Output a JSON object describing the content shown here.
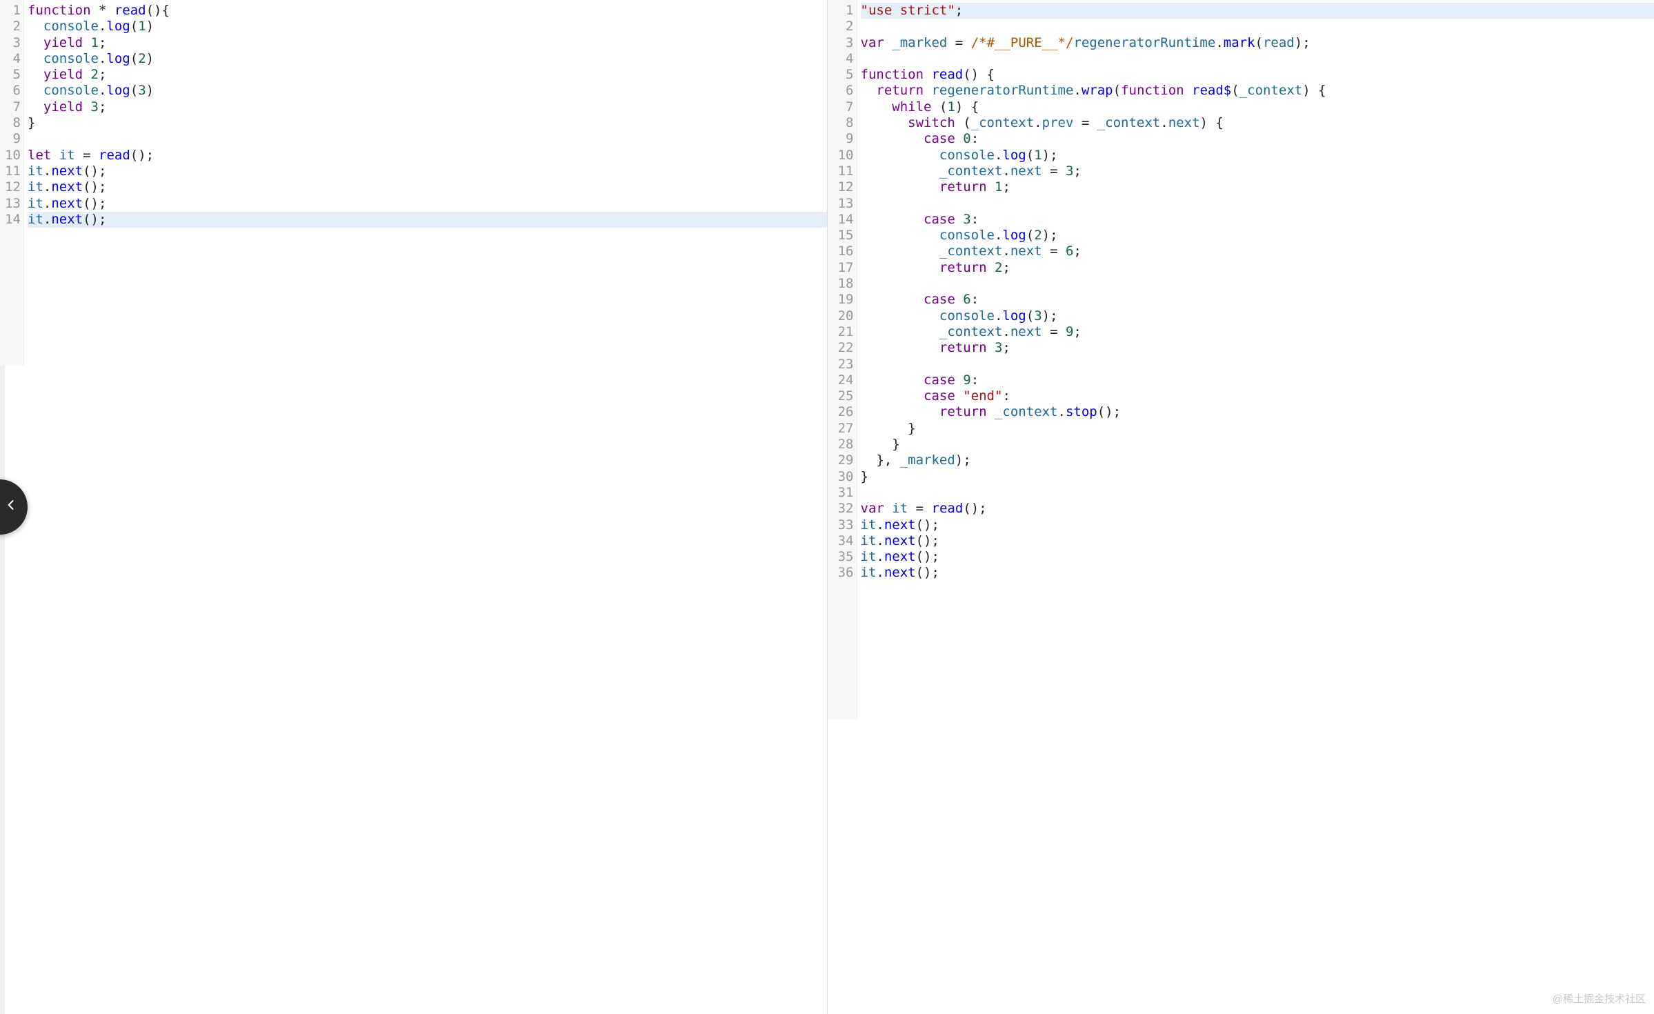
{
  "watermark": "@稀土掘金技术社区",
  "leftPanel": {
    "highlightedLines": [
      14
    ],
    "lines": [
      {
        "n": 1,
        "tokens": [
          {
            "c": "kw",
            "t": "function"
          },
          {
            "t": " * "
          },
          {
            "c": "fn",
            "t": "read"
          },
          {
            "t": "(){"
          }
        ]
      },
      {
        "n": 2,
        "tokens": [
          {
            "t": "  "
          },
          {
            "c": "v",
            "t": "console"
          },
          {
            "t": "."
          },
          {
            "c": "fn",
            "t": "log"
          },
          {
            "t": "("
          },
          {
            "c": "num",
            "t": "1"
          },
          {
            "t": ")"
          }
        ]
      },
      {
        "n": 3,
        "tokens": [
          {
            "t": "  "
          },
          {
            "c": "kw",
            "t": "yield"
          },
          {
            "t": " "
          },
          {
            "c": "num",
            "t": "1"
          },
          {
            "t": ";"
          }
        ]
      },
      {
        "n": 4,
        "tokens": [
          {
            "t": "  "
          },
          {
            "c": "v",
            "t": "console"
          },
          {
            "t": "."
          },
          {
            "c": "fn",
            "t": "log"
          },
          {
            "t": "("
          },
          {
            "c": "num",
            "t": "2"
          },
          {
            "t": ")"
          }
        ]
      },
      {
        "n": 5,
        "tokens": [
          {
            "t": "  "
          },
          {
            "c": "kw",
            "t": "yield"
          },
          {
            "t": " "
          },
          {
            "c": "num",
            "t": "2"
          },
          {
            "t": ";"
          }
        ]
      },
      {
        "n": 6,
        "tokens": [
          {
            "t": "  "
          },
          {
            "c": "v",
            "t": "console"
          },
          {
            "t": "."
          },
          {
            "c": "fn",
            "t": "log"
          },
          {
            "t": "("
          },
          {
            "c": "num",
            "t": "3"
          },
          {
            "t": ")"
          }
        ]
      },
      {
        "n": 7,
        "tokens": [
          {
            "t": "  "
          },
          {
            "c": "kw",
            "t": "yield"
          },
          {
            "t": " "
          },
          {
            "c": "num",
            "t": "3"
          },
          {
            "t": ";"
          }
        ]
      },
      {
        "n": 8,
        "tokens": [
          {
            "t": "}"
          }
        ]
      },
      {
        "n": 9,
        "tokens": []
      },
      {
        "n": 10,
        "tokens": [
          {
            "c": "kw",
            "t": "let"
          },
          {
            "t": " "
          },
          {
            "c": "v",
            "t": "it"
          },
          {
            "t": " = "
          },
          {
            "c": "fn",
            "t": "read"
          },
          {
            "t": "();"
          }
        ]
      },
      {
        "n": 11,
        "tokens": [
          {
            "c": "v",
            "t": "it"
          },
          {
            "t": "."
          },
          {
            "c": "fn",
            "t": "next"
          },
          {
            "t": "();"
          }
        ]
      },
      {
        "n": 12,
        "tokens": [
          {
            "c": "v",
            "t": "it"
          },
          {
            "t": "."
          },
          {
            "c": "fn",
            "t": "next"
          },
          {
            "t": "();"
          }
        ]
      },
      {
        "n": 13,
        "tokens": [
          {
            "c": "v",
            "t": "it"
          },
          {
            "t": "."
          },
          {
            "c": "fn",
            "t": "next"
          },
          {
            "t": "();"
          }
        ]
      },
      {
        "n": 14,
        "tokens": [
          {
            "c": "v",
            "t": "it"
          },
          {
            "t": "."
          },
          {
            "c": "fn",
            "t": "next"
          },
          {
            "t": "();"
          }
        ]
      }
    ]
  },
  "rightPanel": {
    "highlightedLines": [
      1
    ],
    "lines": [
      {
        "n": 1,
        "tokens": [
          {
            "c": "str",
            "t": "\"use strict\""
          },
          {
            "t": ";"
          }
        ]
      },
      {
        "n": 2,
        "tokens": []
      },
      {
        "n": 3,
        "tokens": [
          {
            "c": "kw",
            "t": "var"
          },
          {
            "t": " "
          },
          {
            "c": "v",
            "t": "_marked"
          },
          {
            "t": " = "
          },
          {
            "c": "com",
            "t": "/*#__PURE__*/"
          },
          {
            "c": "v",
            "t": "regeneratorRuntime"
          },
          {
            "t": "."
          },
          {
            "c": "fn",
            "t": "mark"
          },
          {
            "t": "("
          },
          {
            "c": "v",
            "t": "read"
          },
          {
            "t": ");"
          }
        ]
      },
      {
        "n": 4,
        "tokens": []
      },
      {
        "n": 5,
        "tokens": [
          {
            "c": "kw",
            "t": "function"
          },
          {
            "t": " "
          },
          {
            "c": "fn",
            "t": "read"
          },
          {
            "t": "() {"
          }
        ]
      },
      {
        "n": 6,
        "tokens": [
          {
            "t": "  "
          },
          {
            "c": "kw",
            "t": "return"
          },
          {
            "t": " "
          },
          {
            "c": "v",
            "t": "regeneratorRuntime"
          },
          {
            "t": "."
          },
          {
            "c": "fn",
            "t": "wrap"
          },
          {
            "t": "("
          },
          {
            "c": "kw",
            "t": "function"
          },
          {
            "t": " "
          },
          {
            "c": "fn",
            "t": "read$"
          },
          {
            "t": "("
          },
          {
            "c": "v",
            "t": "_context"
          },
          {
            "t": ") {"
          }
        ]
      },
      {
        "n": 7,
        "tokens": [
          {
            "t": "    "
          },
          {
            "c": "kw",
            "t": "while"
          },
          {
            "t": " ("
          },
          {
            "c": "num",
            "t": "1"
          },
          {
            "t": ") {"
          }
        ]
      },
      {
        "n": 8,
        "tokens": [
          {
            "t": "      "
          },
          {
            "c": "kw",
            "t": "switch"
          },
          {
            "t": " ("
          },
          {
            "c": "v",
            "t": "_context"
          },
          {
            "t": "."
          },
          {
            "c": "v",
            "t": "prev"
          },
          {
            "t": " = "
          },
          {
            "c": "v",
            "t": "_context"
          },
          {
            "t": "."
          },
          {
            "c": "v",
            "t": "next"
          },
          {
            "t": ") {"
          }
        ]
      },
      {
        "n": 9,
        "tokens": [
          {
            "t": "        "
          },
          {
            "c": "kw",
            "t": "case"
          },
          {
            "t": " "
          },
          {
            "c": "num",
            "t": "0"
          },
          {
            "t": ":"
          }
        ]
      },
      {
        "n": 10,
        "tokens": [
          {
            "t": "          "
          },
          {
            "c": "v",
            "t": "console"
          },
          {
            "t": "."
          },
          {
            "c": "fn",
            "t": "log"
          },
          {
            "t": "("
          },
          {
            "c": "num",
            "t": "1"
          },
          {
            "t": ");"
          }
        ]
      },
      {
        "n": 11,
        "tokens": [
          {
            "t": "          "
          },
          {
            "c": "v",
            "t": "_context"
          },
          {
            "t": "."
          },
          {
            "c": "v",
            "t": "next"
          },
          {
            "t": " = "
          },
          {
            "c": "num",
            "t": "3"
          },
          {
            "t": ";"
          }
        ]
      },
      {
        "n": 12,
        "tokens": [
          {
            "t": "          "
          },
          {
            "c": "kw",
            "t": "return"
          },
          {
            "t": " "
          },
          {
            "c": "num",
            "t": "1"
          },
          {
            "t": ";"
          }
        ]
      },
      {
        "n": 13,
        "tokens": []
      },
      {
        "n": 14,
        "tokens": [
          {
            "t": "        "
          },
          {
            "c": "kw",
            "t": "case"
          },
          {
            "t": " "
          },
          {
            "c": "num",
            "t": "3"
          },
          {
            "t": ":"
          }
        ]
      },
      {
        "n": 15,
        "tokens": [
          {
            "t": "          "
          },
          {
            "c": "v",
            "t": "console"
          },
          {
            "t": "."
          },
          {
            "c": "fn",
            "t": "log"
          },
          {
            "t": "("
          },
          {
            "c": "num",
            "t": "2"
          },
          {
            "t": ");"
          }
        ]
      },
      {
        "n": 16,
        "tokens": [
          {
            "t": "          "
          },
          {
            "c": "v",
            "t": "_context"
          },
          {
            "t": "."
          },
          {
            "c": "v",
            "t": "next"
          },
          {
            "t": " = "
          },
          {
            "c": "num",
            "t": "6"
          },
          {
            "t": ";"
          }
        ]
      },
      {
        "n": 17,
        "tokens": [
          {
            "t": "          "
          },
          {
            "c": "kw",
            "t": "return"
          },
          {
            "t": " "
          },
          {
            "c": "num",
            "t": "2"
          },
          {
            "t": ";"
          }
        ]
      },
      {
        "n": 18,
        "tokens": []
      },
      {
        "n": 19,
        "tokens": [
          {
            "t": "        "
          },
          {
            "c": "kw",
            "t": "case"
          },
          {
            "t": " "
          },
          {
            "c": "num",
            "t": "6"
          },
          {
            "t": ":"
          }
        ]
      },
      {
        "n": 20,
        "tokens": [
          {
            "t": "          "
          },
          {
            "c": "v",
            "t": "console"
          },
          {
            "t": "."
          },
          {
            "c": "fn",
            "t": "log"
          },
          {
            "t": "("
          },
          {
            "c": "num",
            "t": "3"
          },
          {
            "t": ");"
          }
        ]
      },
      {
        "n": 21,
        "tokens": [
          {
            "t": "          "
          },
          {
            "c": "v",
            "t": "_context"
          },
          {
            "t": "."
          },
          {
            "c": "v",
            "t": "next"
          },
          {
            "t": " = "
          },
          {
            "c": "num",
            "t": "9"
          },
          {
            "t": ";"
          }
        ]
      },
      {
        "n": 22,
        "tokens": [
          {
            "t": "          "
          },
          {
            "c": "kw",
            "t": "return"
          },
          {
            "t": " "
          },
          {
            "c": "num",
            "t": "3"
          },
          {
            "t": ";"
          }
        ]
      },
      {
        "n": 23,
        "tokens": []
      },
      {
        "n": 24,
        "tokens": [
          {
            "t": "        "
          },
          {
            "c": "kw",
            "t": "case"
          },
          {
            "t": " "
          },
          {
            "c": "num",
            "t": "9"
          },
          {
            "t": ":"
          }
        ]
      },
      {
        "n": 25,
        "tokens": [
          {
            "t": "        "
          },
          {
            "c": "kw",
            "t": "case"
          },
          {
            "t": " "
          },
          {
            "c": "str",
            "t": "\"end\""
          },
          {
            "t": ":"
          }
        ]
      },
      {
        "n": 26,
        "tokens": [
          {
            "t": "          "
          },
          {
            "c": "kw",
            "t": "return"
          },
          {
            "t": " "
          },
          {
            "c": "v",
            "t": "_context"
          },
          {
            "t": "."
          },
          {
            "c": "fn",
            "t": "stop"
          },
          {
            "t": "();"
          }
        ]
      },
      {
        "n": 27,
        "tokens": [
          {
            "t": "      }"
          }
        ]
      },
      {
        "n": 28,
        "tokens": [
          {
            "t": "    }"
          }
        ]
      },
      {
        "n": 29,
        "tokens": [
          {
            "t": "  }, "
          },
          {
            "c": "v",
            "t": "_marked"
          },
          {
            "t": ");"
          }
        ]
      },
      {
        "n": 30,
        "tokens": [
          {
            "t": "}"
          }
        ]
      },
      {
        "n": 31,
        "tokens": []
      },
      {
        "n": 32,
        "tokens": [
          {
            "c": "kw",
            "t": "var"
          },
          {
            "t": " "
          },
          {
            "c": "v",
            "t": "it"
          },
          {
            "t": " = "
          },
          {
            "c": "fn",
            "t": "read"
          },
          {
            "t": "();"
          }
        ]
      },
      {
        "n": 33,
        "tokens": [
          {
            "c": "v",
            "t": "it"
          },
          {
            "t": "."
          },
          {
            "c": "fn",
            "t": "next"
          },
          {
            "t": "();"
          }
        ]
      },
      {
        "n": 34,
        "tokens": [
          {
            "c": "v",
            "t": "it"
          },
          {
            "t": "."
          },
          {
            "c": "fn",
            "t": "next"
          },
          {
            "t": "();"
          }
        ]
      },
      {
        "n": 35,
        "tokens": [
          {
            "c": "v",
            "t": "it"
          },
          {
            "t": "."
          },
          {
            "c": "fn",
            "t": "next"
          },
          {
            "t": "();"
          }
        ]
      },
      {
        "n": 36,
        "tokens": [
          {
            "c": "v",
            "t": "it"
          },
          {
            "t": "."
          },
          {
            "c": "fn",
            "t": "next"
          },
          {
            "t": "();"
          }
        ]
      }
    ]
  }
}
